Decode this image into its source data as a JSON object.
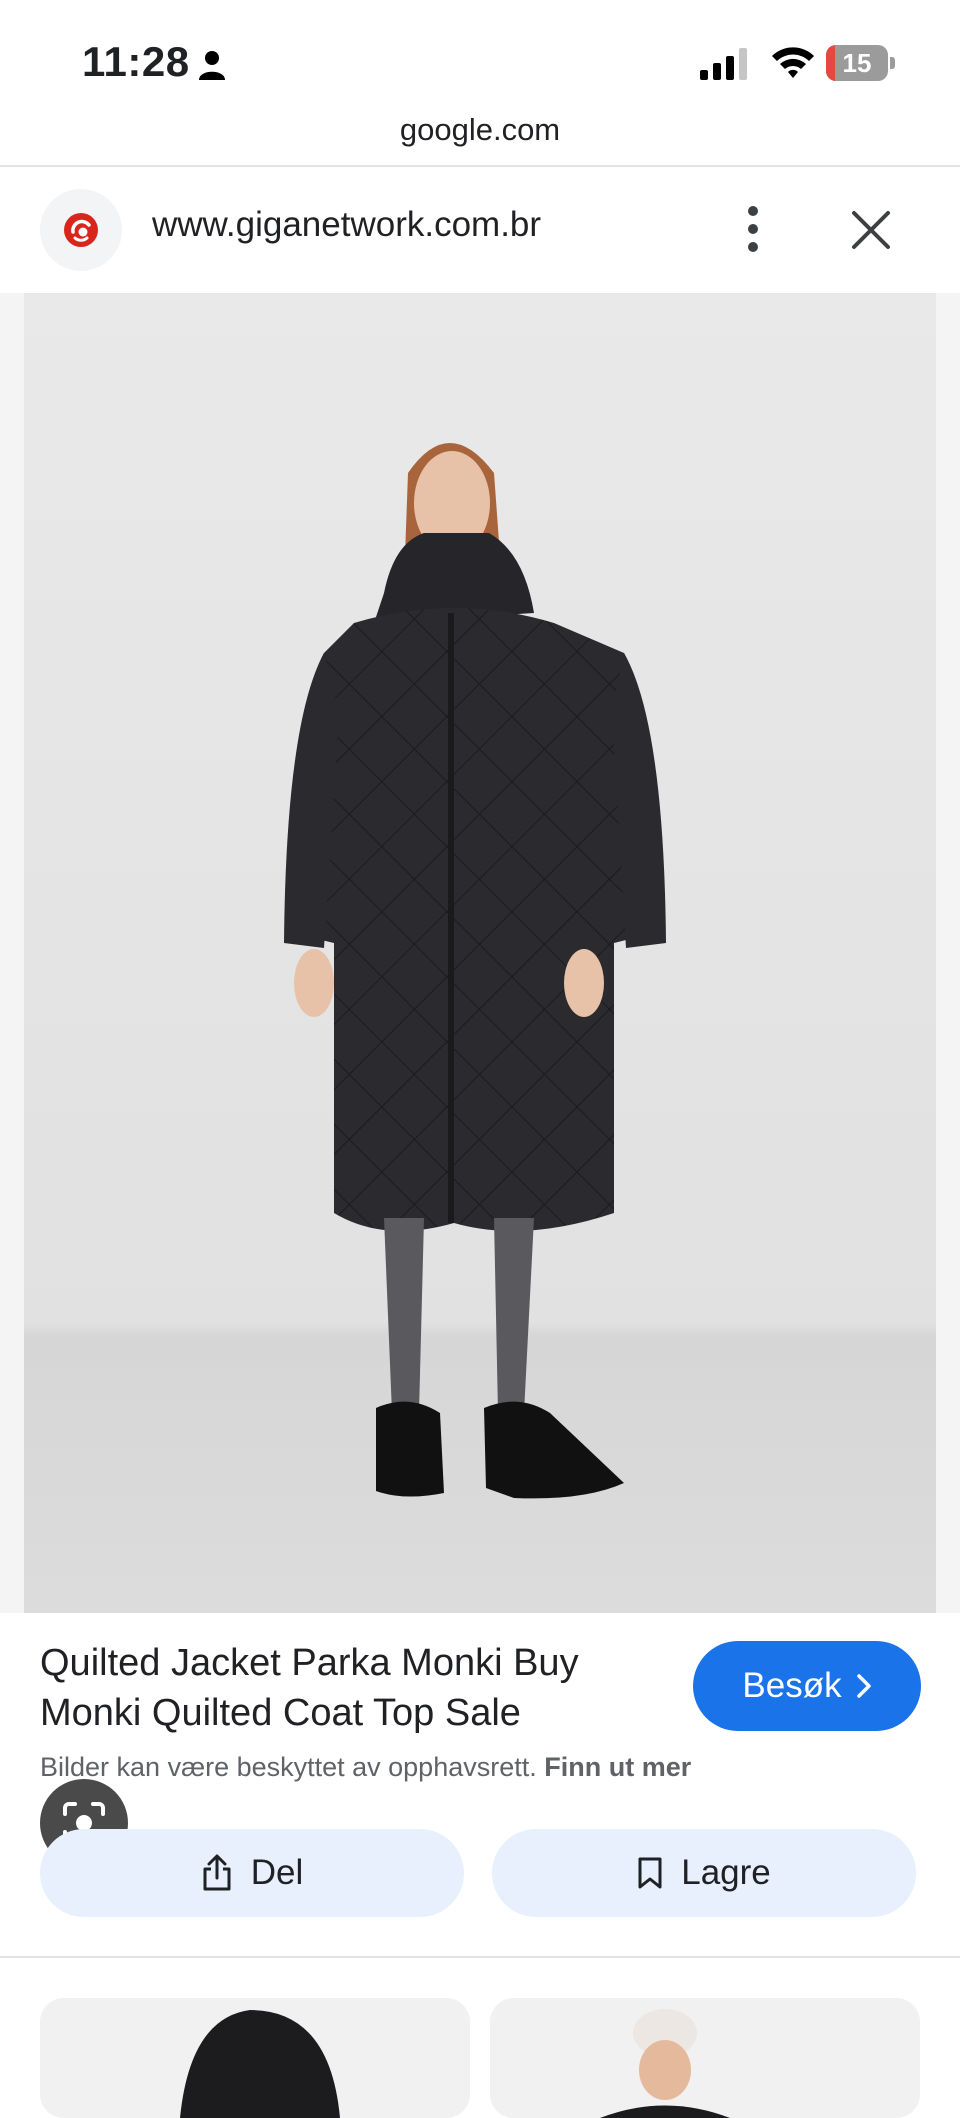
{
  "status_bar": {
    "time": "11:28",
    "battery_level": 15,
    "battery_percent_fraction": 0.15
  },
  "browser": {
    "host": "google.com"
  },
  "site": {
    "url": "www.giganetwork.com.br"
  },
  "result": {
    "title": "Quilted Jacket Parka Monki Buy Monki Quilted Coat Top Sale",
    "visit_label": "Besøk",
    "copyright_text": "Bilder kan være beskyttet av opphavsrett.",
    "learn_more": "Finn ut mer"
  },
  "actions": {
    "share_label": "Del",
    "save_label": "Lagre"
  },
  "colors": {
    "accent": "#1a73e8",
    "action_bg": "#e8effd",
    "battery_low": "#e5483f",
    "coat": "#2b2b2f"
  }
}
